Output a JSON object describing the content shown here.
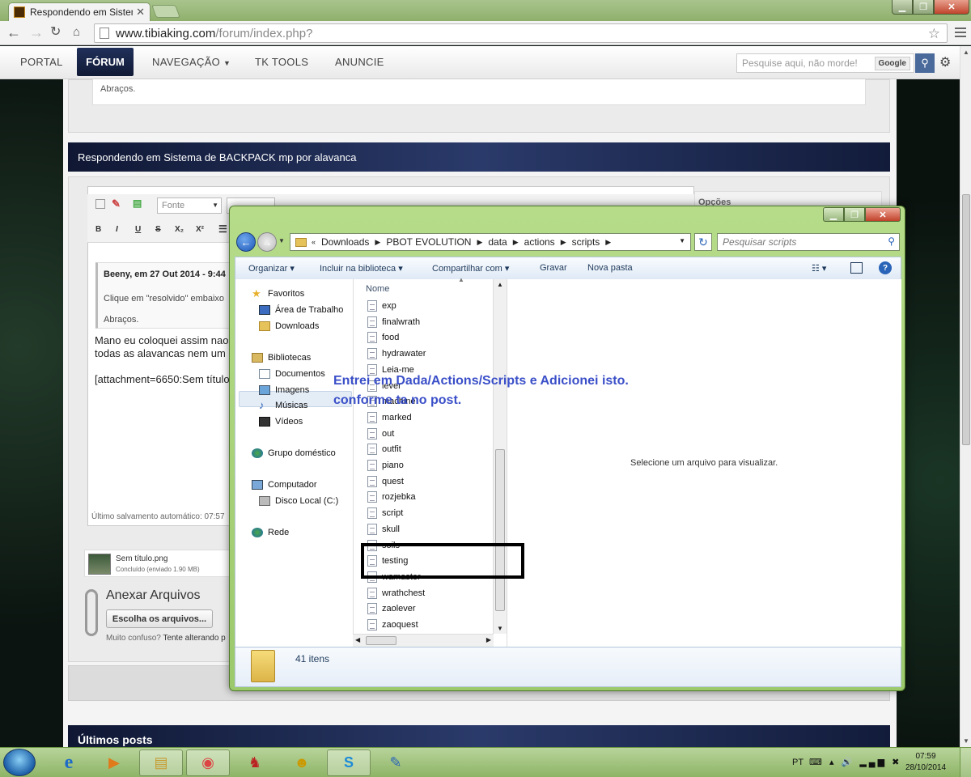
{
  "browser": {
    "tab_title": "Respondendo em Sistema",
    "url_domain": "www.tibiaking.com",
    "url_path": "/forum/index.php?"
  },
  "site_nav": {
    "items": [
      "PORTAL",
      "FÓRUM",
      "NAVEGAÇÃO",
      "TK TOOLS",
      "ANUNCIE"
    ],
    "search_placeholder": "Pesquise aqui, não morde!",
    "google_label": "Google"
  },
  "forum": {
    "quote_tail": "Abraços.",
    "section_title": "Respondendo em Sistema de BACKPACK mp por alavanca",
    "options_label": "Opções",
    "font_select": "Fonte",
    "quote_header": "Beeny, em 27 Out 2014 - 9:44",
    "quote_line1": "Clique em \"resolvido\" embaixo",
    "quote_line2": "Abraços.",
    "reply_line1": "Mano eu coloquei assim nao",
    "reply_line2": "todas as alavancas nem um",
    "reply_line3": "[attachment=6650:Sem título",
    "autosave": "Último salvamento automático: 07:57",
    "attachment_name": "Sem título.png",
    "attachment_status": "Concluído (enviado 1.90 MB)",
    "attach_heading": "Anexar Arquivos",
    "choose_files": "Escolha os arquivos...",
    "confused_prefix": "Muito confuso?",
    "confused_text": "Tente alterando p",
    "latest_posts": "Últimos posts"
  },
  "explorer": {
    "breadcrumb": [
      "Downloads",
      "PBOT EVOLUTION",
      "data",
      "actions",
      "scripts"
    ],
    "search_placeholder": "Pesquisar scripts",
    "commands": [
      "Organizar ▾",
      "Incluir na biblioteca ▾",
      "Compartilhar com ▾",
      "Gravar",
      "Nova pasta"
    ],
    "nav": {
      "favorites": "Favoritos",
      "desktop": "Área de Trabalho",
      "downloads": "Downloads",
      "libraries": "Bibliotecas",
      "documents": "Documentos",
      "images": "Imagens",
      "music": "Músicas",
      "videos": "Vídeos",
      "homegroup": "Grupo doméstico",
      "computer": "Computador",
      "local_disk": "Disco Local (C:)",
      "network": "Rede"
    },
    "column_name": "Nome",
    "files": [
      "exp",
      "finalwrath",
      "food",
      "hydrawater",
      "Leia-me",
      "lever",
      "machine",
      "marked",
      "out",
      "outfit",
      "piano",
      "quest",
      "rozjebka",
      "script",
      "skull",
      "soils",
      "testing",
      "wamaster",
      "wrathchest",
      "zaolever",
      "zaoquest"
    ],
    "preview_message": "Selecione um arquivo para visualizar.",
    "item_count": "41 itens",
    "annotation_line1": "Entrei em Dada/Actions/Scripts e Adicionei isto.",
    "annotation_line2": "conforme ta no post."
  },
  "taskbar": {
    "language": "PT",
    "time": "07:59",
    "date": "28/10/2014"
  }
}
